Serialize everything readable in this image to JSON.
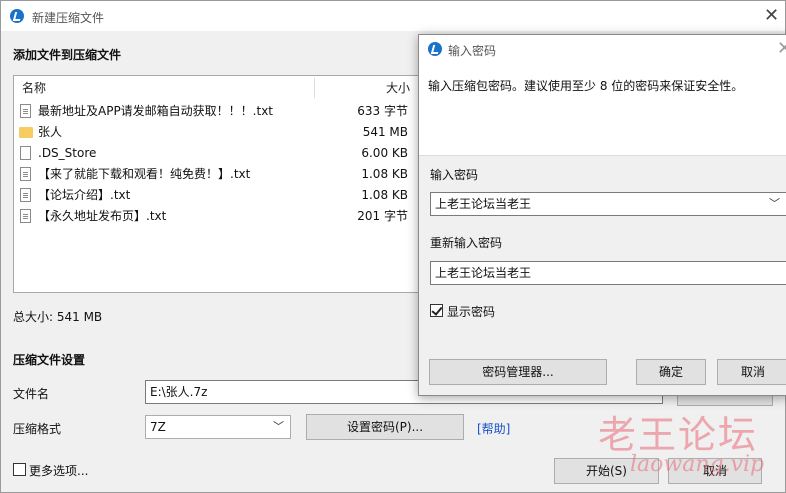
{
  "main_window": {
    "title": "新建压缩文件",
    "add_section_title": "添加文件到压缩文件",
    "columns": {
      "name": "名称",
      "size": "大小"
    },
    "files": [
      {
        "name": "最新地址及APP请发邮箱自动获取！！！.txt",
        "size": "633 字节",
        "icon": "text-file-icon"
      },
      {
        "name": "张人",
        "size": "541 MB",
        "icon": "folder-icon"
      },
      {
        "name": ".DS_Store",
        "size": "6.00 KB",
        "icon": "file-icon"
      },
      {
        "name": "【来了就能下载和观看！纯免费！】.txt",
        "size": "1.08 KB",
        "icon": "text-file-icon"
      },
      {
        "name": "【论坛介绍】.txt",
        "size": "1.08 KB",
        "icon": "text-file-icon"
      },
      {
        "name": "【永久地址发布页】.txt",
        "size": "201 字节",
        "icon": "text-file-icon"
      }
    ],
    "total_size": "总大小: 541 MB",
    "settings_title": "压缩文件设置",
    "filename_label": "文件名",
    "filename_value": "E:\\张人.7z",
    "format_label": "压缩格式",
    "format_value": "7Z",
    "set_password_button": "设置密码(P)...",
    "help_link": "[帮助]",
    "more_options_label": "更多选项...",
    "start_button": "开始(S)",
    "cancel_button": "取消"
  },
  "password_dialog": {
    "title": "输入密码",
    "description": "输入压缩包密码。建议使用至少 8 位的密码来保证安全性。",
    "password_label": "输入密码",
    "password_value": "上老王论坛当老王",
    "confirm_label": "重新输入密码",
    "confirm_value": "上老王论坛当老王",
    "show_password_label": "显示密码",
    "show_password_checked": true,
    "manager_button": "密码管理器...",
    "ok_button": "确定",
    "cancel_button": "取消"
  },
  "watermark": {
    "text": "老王论坛",
    "subtext": "laowang.vip"
  }
}
